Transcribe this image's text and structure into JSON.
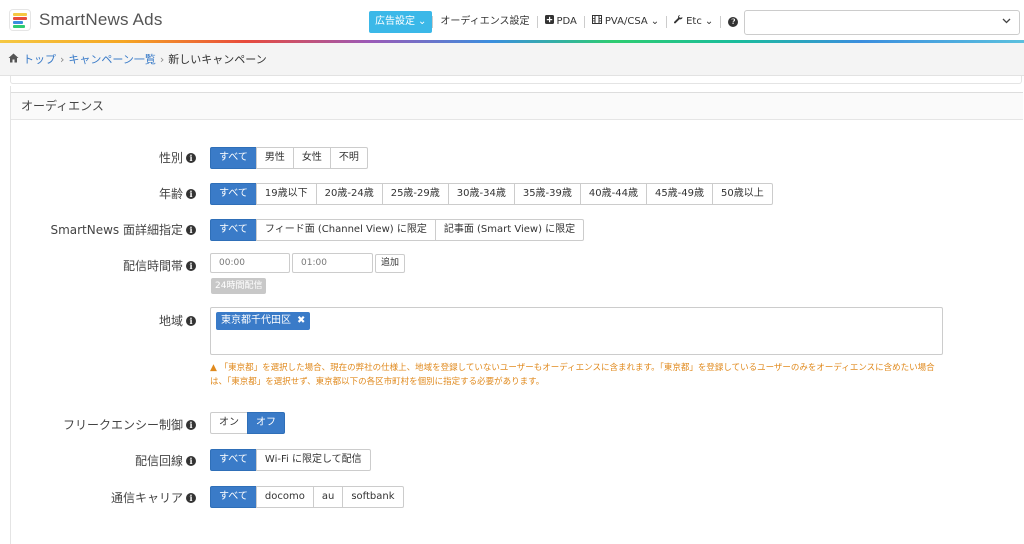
{
  "app": {
    "logo_text": "SmartNews Ads"
  },
  "nav": {
    "items": [
      {
        "label": "広告設定",
        "caret": "⌄",
        "active": true
      },
      {
        "label": "オーディエンス設定"
      },
      {
        "icon": "plus-square-icon",
        "label": "PDA"
      },
      {
        "icon": "film-icon",
        "label": "PVA/CSA",
        "caret": "⌄"
      },
      {
        "icon": "wrench-icon",
        "label": "Etc",
        "caret": "⌄"
      },
      {
        "icon": "question-icon",
        "label": ""
      }
    ],
    "account_select_value": ""
  },
  "breadcrumb": {
    "home": "トップ",
    "list": "キャンペーン一覧",
    "current": "新しいキャンペーン"
  },
  "section": {
    "title": "オーディエンス"
  },
  "fields": {
    "gender": {
      "label": "性別",
      "options": [
        "すべて",
        "男性",
        "女性",
        "不明"
      ],
      "selected": "すべて"
    },
    "age": {
      "label": "年齢",
      "options": [
        "すべて",
        "19歳以下",
        "20歳-24歳",
        "25歳-29歳",
        "30歳-34歳",
        "35歳-39歳",
        "40歳-44歳",
        "45歳-49歳",
        "50歳以上"
      ],
      "selected": "すべて"
    },
    "detail": {
      "label": "SmartNews 面詳細指定",
      "options": [
        "すべて",
        "フィード面 (Channel View) に限定",
        "記事面 (Smart View) に限定"
      ],
      "selected": "すべて"
    },
    "time": {
      "label": "配信時間帯",
      "start_placeholder": "00:00",
      "end_placeholder": "01:00",
      "add_label": "追加",
      "all_day_label": "24時間配信"
    },
    "region": {
      "label": "地域",
      "tag": "東京都千代田区",
      "warning": "「東京都」を選択した場合、現在の弊社の仕様上、地域を登録していないユーザーもオーディエンスに含まれます。「東京都」を登録しているユーザーのみをオーディエンスに含めたい場合は、「東京都」を選択せず、東京都以下の各区市町村を個別に指定する必要があります。"
    },
    "frequency": {
      "label": "フリークエンシー制御",
      "options": [
        "オン",
        "オフ"
      ],
      "selected": "オフ"
    },
    "connection": {
      "label": "配信回線",
      "options": [
        "すべて",
        "Wi-Fi に限定して配信"
      ],
      "selected": "すべて"
    },
    "carrier": {
      "label": "通信キャリア",
      "options": [
        "すべて",
        "docomo",
        "au",
        "softbank"
      ],
      "selected": "すべて"
    }
  },
  "colors": {
    "primary": "#3a7bc8",
    "nav_active": "#3bb8e8",
    "warning": "#e08a1e"
  }
}
